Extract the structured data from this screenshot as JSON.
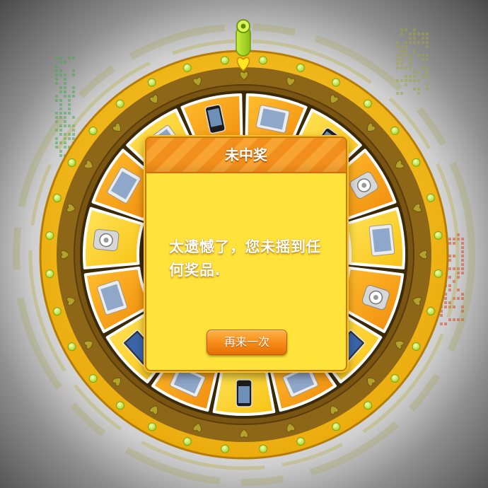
{
  "dialog": {
    "title": "未中奖",
    "message": "太遗憾了，您未摇到任何奖品.",
    "retry_label": "再来一次"
  },
  "wheel": {
    "prize_icons": [
      "tablet-icon",
      "phone-icon",
      "mp3-player-icon",
      "tablet-icon",
      "mp3-player-icon",
      "laptop-icon",
      "tablet-icon",
      "phone-icon",
      "tablet-icon",
      "laptop-icon",
      "tablet-icon",
      "mp3-player-icon",
      "tablet-icon",
      "tablet-icon",
      "phone-icon"
    ],
    "heart_icon": "heart-icon",
    "pointer_icon": "pointer-icon"
  },
  "colors": {
    "ring_gold": "#f3b90c",
    "ring_brown": "#8a6418",
    "segment_orange": "#f59a14",
    "segment_yellow": "#ffd21f",
    "dialog_bg": "#ffe23a",
    "header_orange": "#f28e1b",
    "button_orange": "#f58a16",
    "bulb_green": "#c6f040"
  }
}
